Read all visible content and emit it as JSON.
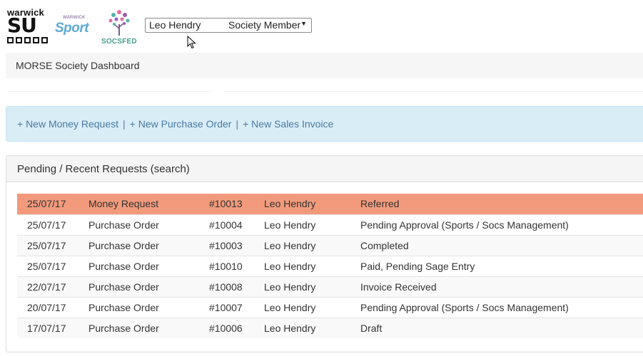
{
  "header": {
    "su_logo": {
      "top_text": "warwick",
      "main_text": "SU"
    },
    "sport_logo": {
      "small_text": "WARWICK",
      "main_text": "Sport"
    },
    "socsfed_logo": {
      "text": "SOCSFED"
    },
    "user_select": {
      "name": "Leo Hendry",
      "role": "Society Member"
    }
  },
  "title": "MORSE Society Dashboard",
  "actions": {
    "new_money_request": "+ New Money Request",
    "new_purchase_order": "+ New Purchase Order",
    "new_sales_invoice": "+ New Sales Invoice",
    "separator": "|"
  },
  "panel": {
    "heading": "Pending / Recent Requests (search)",
    "rows": [
      {
        "date": "25/07/17",
        "type": "Money Request",
        "id": "#10013",
        "user": "Leo Hendry",
        "status": "Referred",
        "state": "danger"
      },
      {
        "date": "25/07/17",
        "type": "Purchase Order",
        "id": "#10004",
        "user": "Leo Hendry",
        "status": "Pending Approval (Sports / Socs Management)",
        "state": "even"
      },
      {
        "date": "25/07/17",
        "type": "Purchase Order",
        "id": "#10003",
        "user": "Leo Hendry",
        "status": "Completed",
        "state": "odd"
      },
      {
        "date": "25/07/17",
        "type": "Purchase Order",
        "id": "#10010",
        "user": "Leo Hendry",
        "status": "Paid, Pending Sage Entry",
        "state": "even"
      },
      {
        "date": "22/07/17",
        "type": "Purchase Order",
        "id": "#10008",
        "user": "Leo Hendry",
        "status": "Invoice Received",
        "state": "odd"
      },
      {
        "date": "20/07/17",
        "type": "Purchase Order",
        "id": "#10007",
        "user": "Leo Hendry",
        "status": "Pending Approval (Sports / Socs Management)",
        "state": "even"
      },
      {
        "date": "17/07/17",
        "type": "Purchase Order",
        "id": "#10006",
        "user": "Leo Hendry",
        "status": "Draft",
        "state": "odd"
      }
    ]
  },
  "colors": {
    "danger_row": "#f29a7b",
    "info_bar": "#d9edf7",
    "link": "#4a7aa2",
    "sport_blue": "#5da9d6",
    "socsfed_teal": "#4a9b8f"
  }
}
